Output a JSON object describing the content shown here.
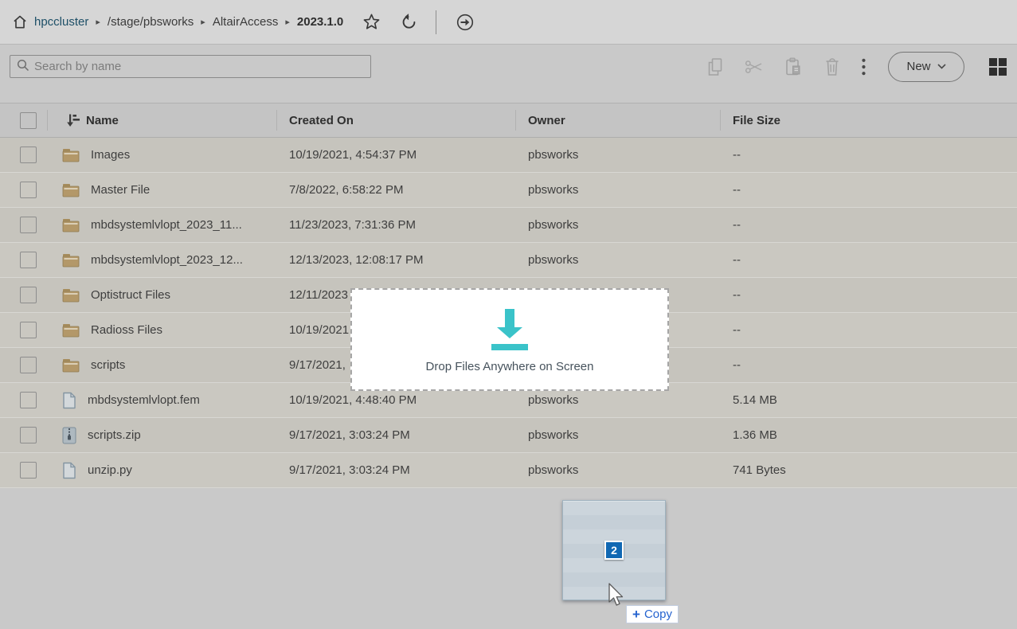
{
  "breadcrumb": {
    "separator": "▸",
    "items": [
      {
        "label": "hpccluster"
      },
      {
        "label": "/stage/pbsworks"
      },
      {
        "label": "AltairAccess"
      },
      {
        "label": "2023.1.0"
      }
    ]
  },
  "toolbar": {
    "search_placeholder": "Search by name",
    "new_button": {
      "label": "New"
    },
    "icons": [
      "copy",
      "cut",
      "paste",
      "delete",
      "more-options",
      "grid-view"
    ]
  },
  "table": {
    "columns": [
      "Name",
      "Created On",
      "Owner",
      "File Size"
    ],
    "rows": [
      {
        "name": "Images",
        "type": "folder",
        "created": "10/19/2021, 4:54:37 PM",
        "owner": "pbsworks",
        "size": "--"
      },
      {
        "name": "Master File",
        "type": "folder",
        "created": "7/8/2022, 6:58:22 PM",
        "owner": "pbsworks",
        "size": "--"
      },
      {
        "name": "mbdsystemlvlopt_2023_11...",
        "type": "folder",
        "created": "11/23/2023, 7:31:36 PM",
        "owner": "pbsworks",
        "size": "--"
      },
      {
        "name": "mbdsystemlvlopt_2023_12...",
        "type": "folder",
        "created": "12/13/2023, 12:08:17 PM",
        "owner": "pbsworks",
        "size": "--"
      },
      {
        "name": "Optistruct Files",
        "type": "folder",
        "created": "12/11/2023",
        "owner": "",
        "size": "--"
      },
      {
        "name": "Radioss Files",
        "type": "folder",
        "created": "10/19/2021",
        "owner": "",
        "size": "--"
      },
      {
        "name": "scripts",
        "type": "folder",
        "created": "9/17/2021,",
        "owner": "",
        "size": "--"
      },
      {
        "name": "mbdsystemlvlopt.fem",
        "type": "file",
        "created": "10/19/2021, 4:48:40 PM",
        "owner": "pbsworks",
        "size": "5.14 MB"
      },
      {
        "name": "scripts.zip",
        "type": "zip",
        "created": "9/17/2021, 3:03:24 PM",
        "owner": "pbsworks",
        "size": "1.36 MB"
      },
      {
        "name": "unzip.py",
        "type": "file",
        "created": "9/17/2021, 3:03:24 PM",
        "owner": "pbsworks",
        "size": "741 Bytes"
      }
    ]
  },
  "drop_overlay": {
    "text": "Drop Files Anywhere on Screen"
  },
  "drag_ghost": {
    "count": "2",
    "plus": "+",
    "action_label": "Copy"
  },
  "colors": {
    "accent_teal": "#3ac3c9",
    "badge_blue": "#1168b3",
    "copy_blue": "#2563cf",
    "breadcrumb_link": "#1d4f67",
    "folder_tan": "#b39869"
  }
}
